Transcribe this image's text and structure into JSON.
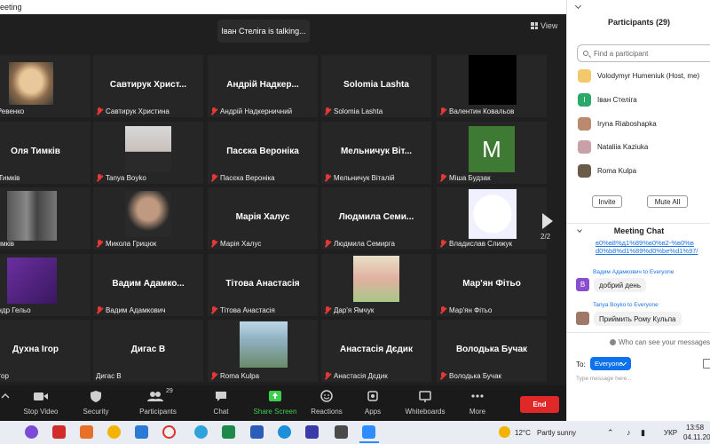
{
  "window": {
    "title": "eeting"
  },
  "top": {
    "talking": "Іван Стеліга is talking...",
    "view_label": "View"
  },
  "tiles": [
    {
      "center": "",
      "foot": "дан Ревенко",
      "muted": false,
      "kind": "photo-bread"
    },
    {
      "center": "Савтирук Христ...",
      "foot": "Савтирук Христина",
      "muted": true
    },
    {
      "center": "Андрій Надкер...",
      "foot": "Андрій Надкерничний",
      "muted": true
    },
    {
      "center": "Solomia Lashta",
      "foot": "Solomia Lashta",
      "muted": true
    },
    {
      "center": "",
      "foot": "Валентин Ковальов",
      "muted": true,
      "kind": "black"
    },
    {
      "center": "Оля Тимків",
      "foot": "Оля Тимків",
      "muted": false
    },
    {
      "center": "",
      "foot": "Tanya Boyko",
      "muted": true,
      "kind": "photo-girl"
    },
    {
      "center": "Пасєка Вероніка",
      "foot": "Пасєка Вероніка",
      "muted": true
    },
    {
      "center": "Мельничук Віт...",
      "foot": "Мельничук Віталій",
      "muted": true
    },
    {
      "center": "",
      "foot": "Міша Будзак",
      "muted": true,
      "kind": "letter-m"
    },
    {
      "center": "",
      "foot": "Тимків",
      "muted": true,
      "kind": "photo-room"
    },
    {
      "center": "",
      "foot": "Микола Грицюк",
      "muted": true,
      "kind": "photo-boy"
    },
    {
      "center": "Марія Халус",
      "foot": "Марія Халус",
      "muted": true
    },
    {
      "center": "Людмила Семи...",
      "foot": "Людмила Семирга",
      "muted": true
    },
    {
      "center": "",
      "foot": "Владислав Слижук",
      "muted": true,
      "kind": "photo-stars"
    },
    {
      "center": "",
      "foot": "ександр Гельо",
      "muted": false,
      "kind": "photo-ps"
    },
    {
      "center": "Вадим Адамко...",
      "foot": "Вадим Адамкович",
      "muted": true
    },
    {
      "center": "Тітова Анастасія",
      "foot": "Тітова Анастасія",
      "muted": true
    },
    {
      "center": "",
      "foot": "Дар'я Ямчук",
      "muted": true,
      "kind": "photo-child"
    },
    {
      "center": "Мар'ян Фітьо",
      "foot": "Мар'ян Фітьо",
      "muted": true
    },
    {
      "center": "Духна Ігор",
      "foot": "хна Ігор",
      "muted": false
    },
    {
      "center": "Дигас В",
      "foot": "Дигас В",
      "muted": false
    },
    {
      "center": "",
      "foot": "Roma Kulpa",
      "muted": true,
      "kind": "photo-bear"
    },
    {
      "center": "Анастасія Дєдик",
      "foot": "Анастасія Дєдик",
      "muted": true
    },
    {
      "center": "Володька Бучак",
      "foot": "Володька Бучак",
      "muted": true
    }
  ],
  "pager": {
    "page": "2/2"
  },
  "toolbar": {
    "stop_video": "Stop Video",
    "security": "Security",
    "participants": "Participants",
    "participants_count": "29",
    "chat": "Chat",
    "share_screen": "Share Screen",
    "reactions": "Reactions",
    "apps": "Apps",
    "whiteboards": "Whiteboards",
    "more": "More",
    "end": "End"
  },
  "panel": {
    "title": "Participants (29)",
    "search_placeholder": "Find a participant",
    "participants": [
      {
        "name": "Volodymyr Humeniuk (Host, me)",
        "avatar": "#f2c86a"
      },
      {
        "name": "Іван Стеліга",
        "avatar": "#2aa96a",
        "initial": "І"
      },
      {
        "name": "Iryna Riaboshapka",
        "avatar": "#b98a6e"
      },
      {
        "name": "Nataliia Kaziuka",
        "avatar": "#c7a0a8"
      },
      {
        "name": "Roma Kulpa",
        "avatar": "#6a5a4a"
      }
    ],
    "invite": "Invite",
    "mute_all": "Mute All"
  },
  "chat": {
    "title": "Meeting Chat",
    "link_text": "d0%b8%d1%89%d0%be%d1%97/",
    "link_top": "в0%в8%д1%89%в0%в2-%в0%в",
    "messages": [
      {
        "sender": "Вадим Адамкович to Everyone",
        "initial": "В",
        "text": "добрий день"
      },
      {
        "sender": "Tanya Boyko to Everyone",
        "text": "Приймить Рому Кульпа"
      }
    ],
    "who_can_see": "Who can see your messages?",
    "to_label": "To:",
    "recipient": "Everyone",
    "placeholder": "Type message here..."
  },
  "taskbar": {
    "weather_temp": "12°C",
    "weather_text": "Partly sunny",
    "lang": "УКР",
    "time": "13:58",
    "date": "04.11.20"
  }
}
